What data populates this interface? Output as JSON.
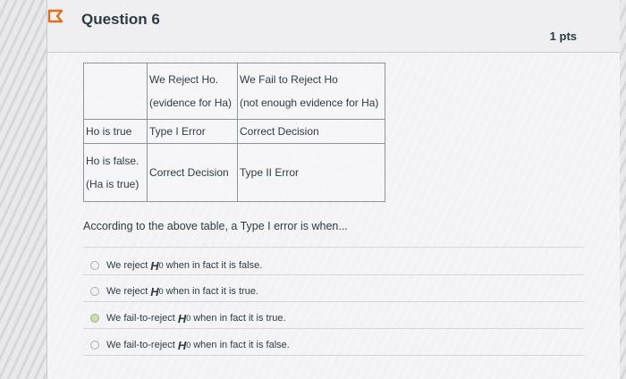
{
  "question": {
    "title": "Question 6",
    "points": "1 pts"
  },
  "table": {
    "col_reject_line1": "We Reject Ho.",
    "col_reject_line2": "(evidence for Ha)",
    "col_fail_line1": "We Fail to Reject Ho",
    "col_fail_line2": "(not enough evidence for Ha)",
    "row_true_label": "Ho is true",
    "row_true_reject": "Type I Error",
    "row_true_fail": "Correct Decision",
    "row_false_label_line1": "Ho is false.",
    "row_false_label_line2": "(Ha is true)",
    "row_false_reject": "Correct Decision",
    "row_false_fail": "Type II Error"
  },
  "prompt": "According to the above table, a Type I error is when...",
  "options": [
    {
      "pre": "We reject",
      "sym": "H",
      "sub": "0",
      "post": "when in fact it is false."
    },
    {
      "pre": "We reject",
      "sym": "H",
      "sub": "0",
      "post": "when in fact it is true."
    },
    {
      "pre": "We fail-to-reject",
      "sym": "H",
      "sub": "0",
      "post": "when in fact it is true."
    },
    {
      "pre": "We fail-to-reject",
      "sym": "H",
      "sub": "0",
      "post": "when in fact it is false."
    }
  ],
  "colors": {
    "text": "#2d3b45",
    "flag": "#e66b1a",
    "radio_highlight": "#c9ddb2"
  },
  "icons": {
    "flag": "flag-outline-icon",
    "radio": "radio-button-icon"
  }
}
